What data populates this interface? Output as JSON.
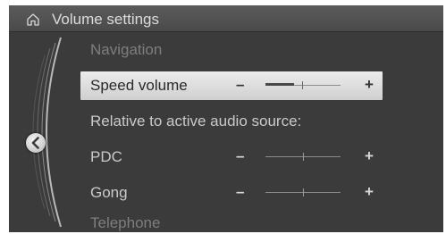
{
  "header": {
    "title": "Volume settings",
    "home_icon": "home-icon"
  },
  "menu": {
    "items": [
      {
        "label": "Navigation",
        "state": "faded"
      },
      {
        "label": "Speed volume",
        "state": "selected",
        "has_slider": true,
        "level": 0.55
      },
      {
        "label": "Relative to active audio source:",
        "state": "normal"
      },
      {
        "label": "PDC",
        "state": "normal",
        "has_slider": true,
        "level": 0.5
      },
      {
        "label": "Gong",
        "state": "normal",
        "has_slider": true,
        "level": 0.5
      },
      {
        "label": "Telephone",
        "state": "faded"
      }
    ],
    "minus_symbol": "–",
    "plus_symbol": "+"
  },
  "nav": {
    "back_icon": "chevron-left-icon"
  },
  "colors": {
    "background": "#3b3b3b",
    "header": "#505050",
    "selection": "#dcdcdc",
    "text": "#c9c9c9",
    "faded_text": "#7e7e7e"
  }
}
